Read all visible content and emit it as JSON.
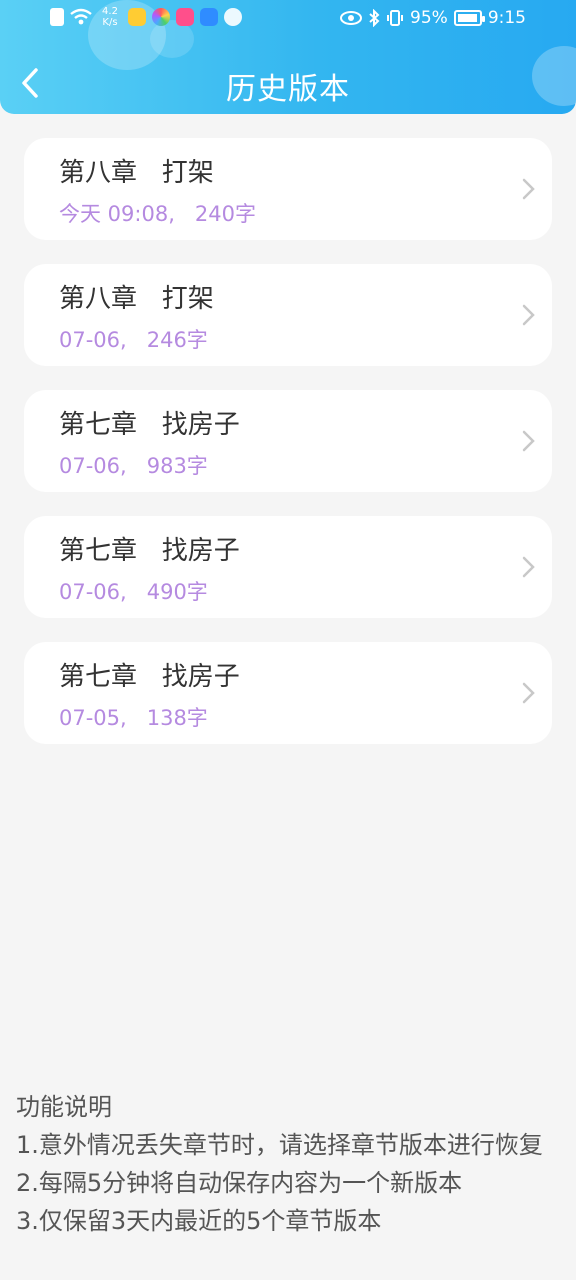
{
  "status_bar": {
    "net_speed_value": "4.2",
    "net_speed_unit": "K/s",
    "battery": "95%",
    "time": "9:15"
  },
  "header": {
    "title": "历史版本"
  },
  "versions": [
    {
      "title": "第八章   打架",
      "meta": "今天 09:08,   240字"
    },
    {
      "title": "第八章   打架",
      "meta": "07-06,   246字"
    },
    {
      "title": "第七章   找房子",
      "meta": "07-06,   983字"
    },
    {
      "title": "第七章   找房子",
      "meta": "07-06,   490字"
    },
    {
      "title": "第七章   找房子",
      "meta": "07-05,   138字"
    }
  ],
  "notes": {
    "heading": "功能说明",
    "line1": "1.意外情况丢失章节时，请选择章节版本进行恢复",
    "line2": "2.每隔5分钟将自动保存内容为一个新版本",
    "line3": "3.仅保留3天内最近的5个章节版本"
  },
  "colors": {
    "header_start": "#5ad0f5",
    "header_end": "#27a9f1",
    "meta_text": "#b58ae0"
  }
}
